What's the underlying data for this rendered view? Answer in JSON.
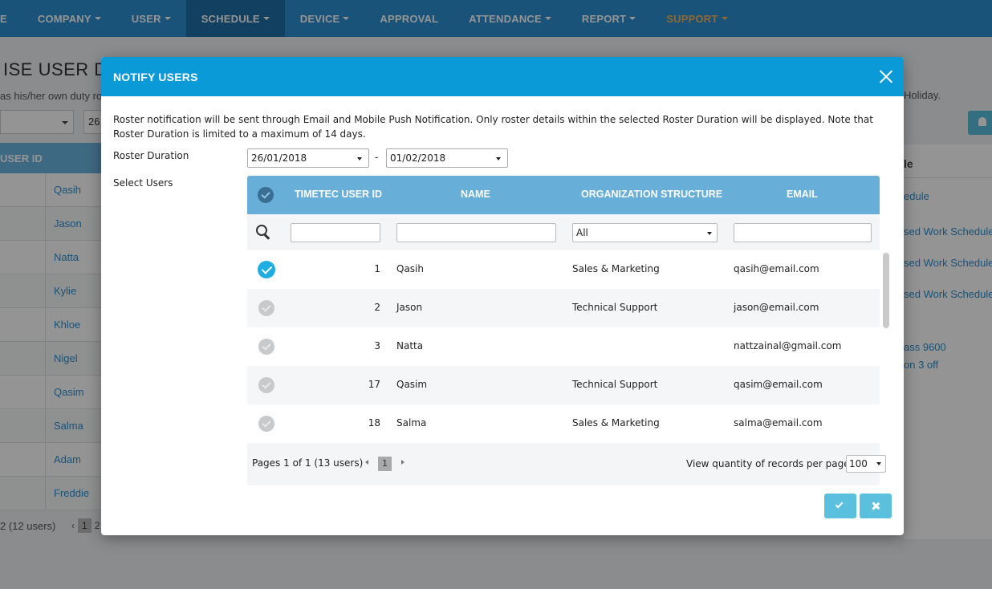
{
  "nav": {
    "items": [
      {
        "label": "E"
      },
      {
        "label": "COMPANY"
      },
      {
        "label": "USER"
      },
      {
        "label": "SCHEDULE"
      },
      {
        "label": "DEVICE"
      },
      {
        "label": "APPROVAL"
      },
      {
        "label": "ATTENDANCE"
      },
      {
        "label": "REPORT"
      },
      {
        "label": "SUPPORT"
      }
    ],
    "active": "SCHEDULE",
    "colors": {
      "bar": "#2b8fd0",
      "active": "#1f6fa7",
      "support": "#f5b35b"
    }
  },
  "background": {
    "title": "ISE USER DUTY",
    "subtitle": "as his/her own duty ro",
    "subtitle_right": "Holiday.",
    "select_value": "26",
    "table_header": "USER ID",
    "user_links": [
      "Qasih",
      "Jason",
      "Natta",
      "Kylie",
      "Khloe",
      "Nigel",
      "Qasim",
      "Salma",
      "Adam",
      "Freddie"
    ],
    "pager_text": "2 (12 users)",
    "pager_pages": [
      "1",
      "2"
    ],
    "right_header": "le",
    "right_links": [
      "edule",
      "sed Work Schedule",
      "sed Work Schedule",
      "sed Work Schedule",
      "ass 9600",
      "on 3 off"
    ]
  },
  "modal": {
    "title": "NOTIFY USERS",
    "notice": "Roster notification will be sent through Email and Mobile Push Notification. Only roster details within the selected Roster Duration will be displayed. Note that Roster Duration is limited to a maximum of 14 days.",
    "roster_duration_label": "Roster Duration",
    "date_from": "26/01/2018",
    "date_separator": "-",
    "date_to": "01/02/2018",
    "select_users_label": "Select Users",
    "table": {
      "columns": [
        "TIMETEC USER ID",
        "NAME",
        "ORGANIZATION STRUCTURE",
        "EMAIL"
      ],
      "org_filter_value": "All",
      "rows": [
        {
          "id": "1",
          "name": "Qasih",
          "org": "Sales & Marketing",
          "email": "qasih@email.com",
          "checked": true
        },
        {
          "id": "2",
          "name": "Jason",
          "org": "Technical Support",
          "email": "jason@email.com",
          "checked": false
        },
        {
          "id": "3",
          "name": "Natta",
          "org": "",
          "email": "nattzainal@gmail.com",
          "checked": false
        },
        {
          "id": "17",
          "name": "Qasim",
          "org": "Technical Support",
          "email": "qasim@email.com",
          "checked": false
        },
        {
          "id": "18",
          "name": "Salma",
          "org": "Sales & Marketing",
          "email": "salma@email.com",
          "checked": false
        }
      ]
    },
    "pager": {
      "text": "Pages 1 of 1 (13 users)",
      "current_page": "1",
      "per_page_label": "View quantity of records per page",
      "per_page_value": "100"
    },
    "colors": {
      "header": "#0a9ad8",
      "table_header": "#67afd9",
      "button": "#5bc0de",
      "checked": "#1eaee3"
    }
  }
}
